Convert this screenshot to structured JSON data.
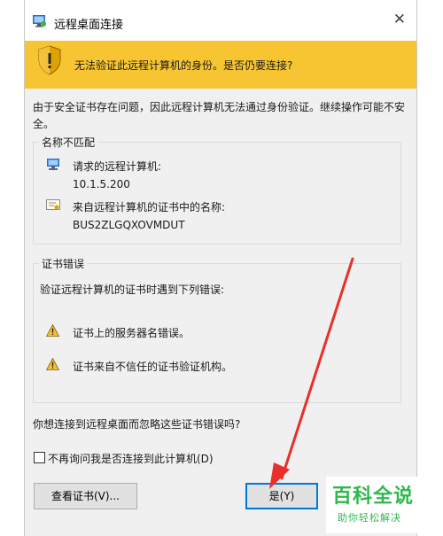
{
  "window": {
    "title": "远程桌面连接",
    "close_glyph": "✕"
  },
  "banner": {
    "text": "无法验证此远程计算机的身份。是否仍要连接?"
  },
  "description": "由于安全证书存在问题，因此远程计算机无法通过身份验证。继续操作可能不安全。",
  "name_mismatch": {
    "title": "名称不匹配",
    "requested_label": "请求的远程计算机:",
    "requested_value": "10.1.5.200",
    "cert_label": "来自远程计算机的证书中的名称:",
    "cert_value": "BUS2ZLGQXOVMDUT"
  },
  "cert_errors": {
    "title": "证书错误",
    "intro": "验证远程计算机的证书时遇到下列错误:",
    "errors": [
      "证书上的服务器名错误。",
      "证书来自不信任的证书验证机构。"
    ]
  },
  "question": "你想连接到远程桌面而忽略这些证书错误吗?",
  "checkbox_label": "不再询问我是否连接到此计算机(D)",
  "buttons": {
    "view_cert": "查看证书(V)...",
    "yes": "是(Y)",
    "no": ""
  },
  "watermark": {
    "title": "百科全说",
    "subtitle": "助你轻松解决"
  },
  "colors": {
    "banner": "#f7c531",
    "dialog_bg": "#f0f0f0",
    "accent": "#0078d7",
    "arrow": "#e8302a",
    "watermark": "#2fb94c"
  }
}
